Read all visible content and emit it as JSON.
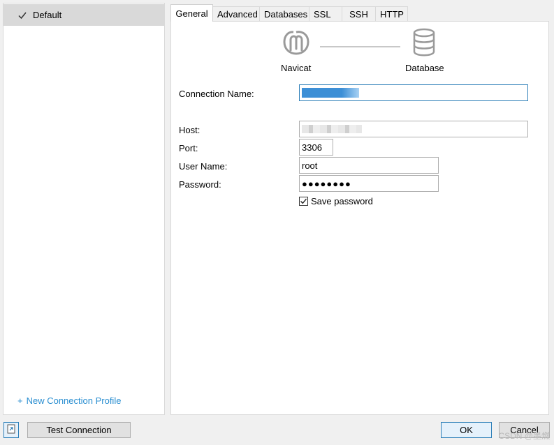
{
  "profiles": {
    "items": [
      {
        "label": "Default",
        "selected": true
      }
    ],
    "new_profile_label": "New Connection Profile",
    "new_profile_plus": "+"
  },
  "tabs": [
    {
      "label": "General",
      "active": true
    },
    {
      "label": "Advanced"
    },
    {
      "label": "Databases"
    },
    {
      "label": "SSL"
    },
    {
      "label": "SSH"
    },
    {
      "label": "HTTP"
    }
  ],
  "diagram": {
    "left_label": "Navicat",
    "right_label": "Database"
  },
  "form": {
    "connection_name_label": "Connection Name:",
    "host_label": "Host:",
    "port_label": "Port:",
    "port_value": "3306",
    "username_label": "User Name:",
    "username_value": "root",
    "password_label": "Password:",
    "password_value": "●●●●●●●●",
    "save_password_label": "Save password",
    "save_password_checked": true
  },
  "footer": {
    "test_connection_label": "Test Connection",
    "ok_label": "OK",
    "cancel_label": "Cancel",
    "watermark": "CSDN @墨燃"
  },
  "colors": {
    "accent": "#2d7fb8",
    "link": "#2b8fd1",
    "selection": "#3d8fd6"
  }
}
